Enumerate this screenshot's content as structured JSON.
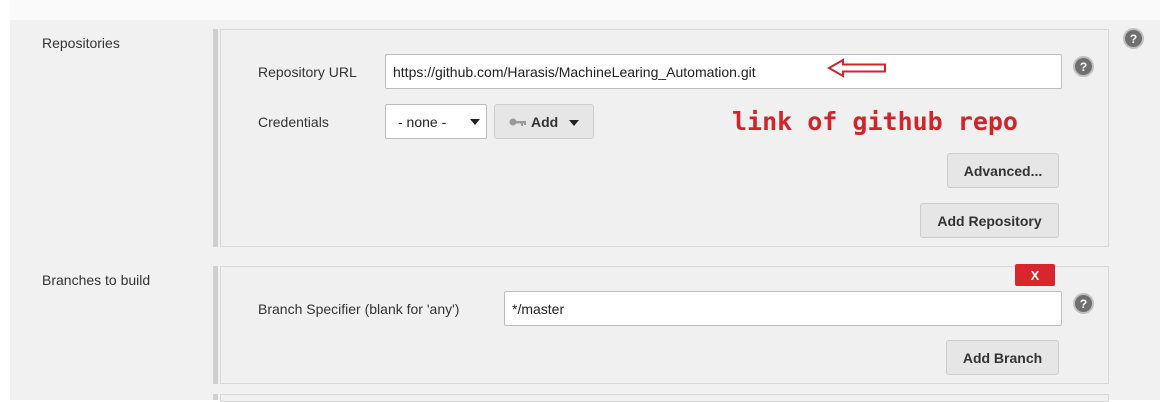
{
  "repositories": {
    "label": "Repositories",
    "repo_url_label": "Repository URL",
    "repo_url_value": "https://github.com/Harasis/MachineLearing_Automation.git",
    "credentials_label": "Credentials",
    "credentials_selected": "- none -",
    "add_credentials_label": "Add",
    "advanced_label": "Advanced...",
    "add_repository_label": "Add Repository"
  },
  "annotation": {
    "text": "link of github repo",
    "color": "#d4232b"
  },
  "branches": {
    "label": "Branches to build",
    "delete_label": "X",
    "specifier_label": "Branch Specifier (blank for 'any')",
    "specifier_value": "*/master",
    "add_branch_label": "Add Branch"
  },
  "help": {
    "glyph": "?"
  },
  "colors": {
    "accent_red": "#d9262c",
    "panel_bg": "#f1f1f1"
  }
}
